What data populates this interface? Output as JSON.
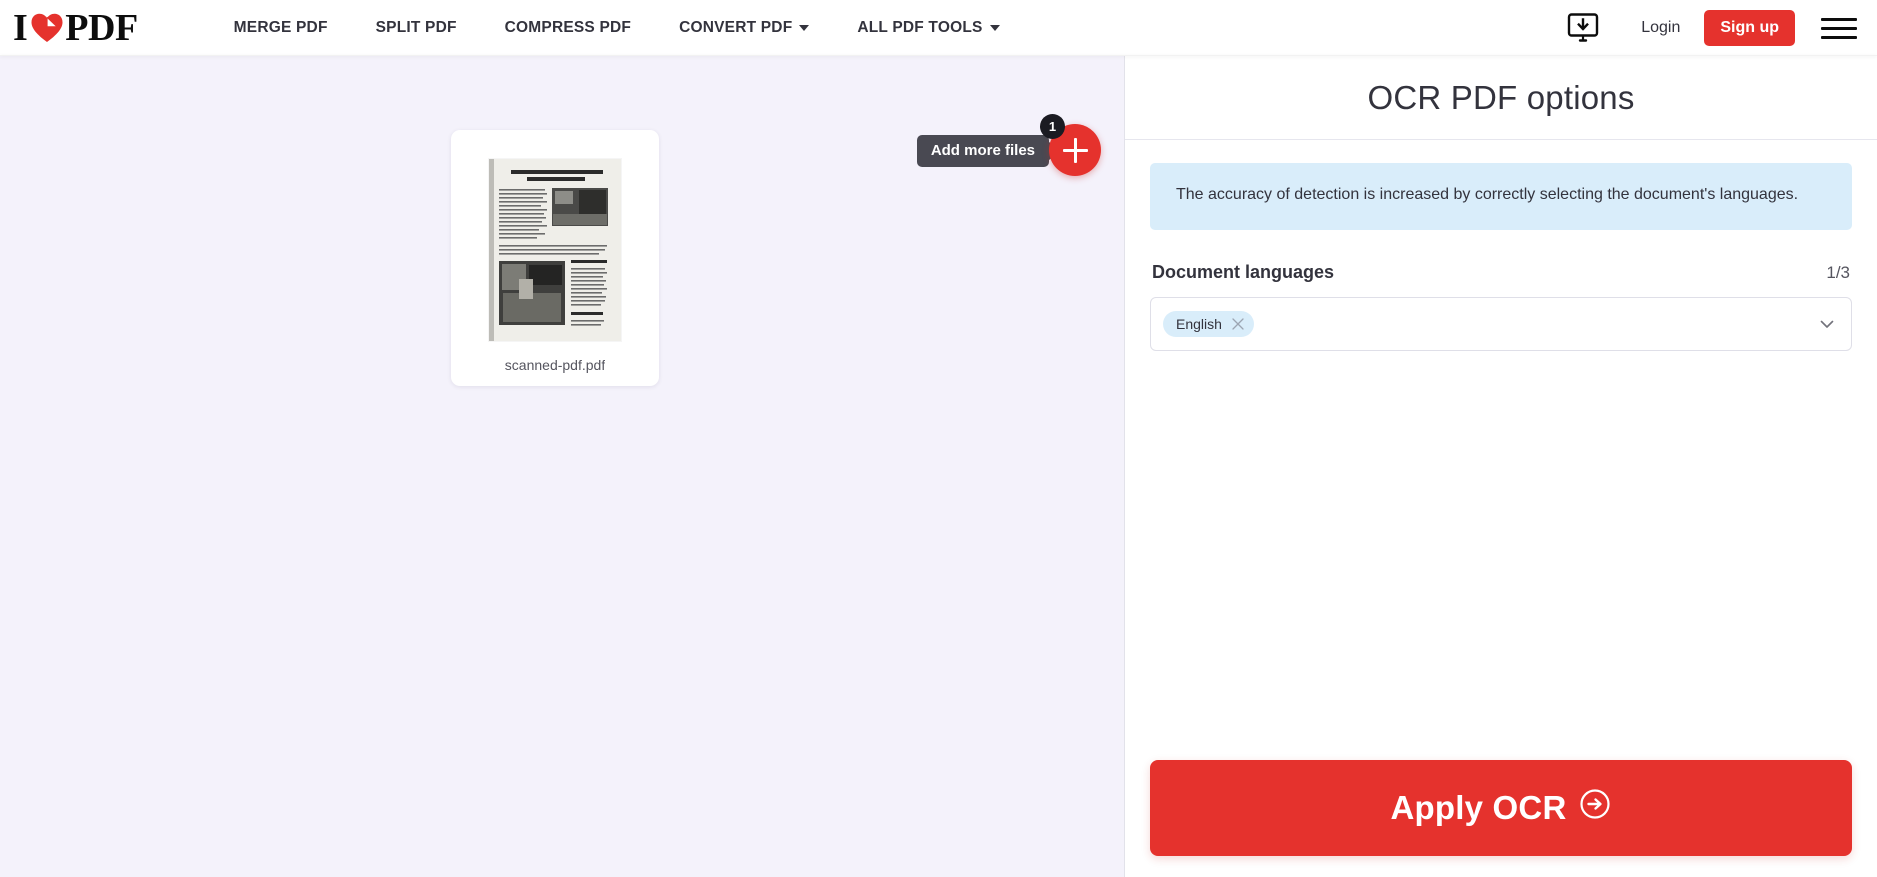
{
  "header": {
    "logo": {
      "left_text": "I",
      "right_text": "PDF",
      "heart_icon": "heart-page-fold-icon",
      "alt": "I LOVE PDF"
    },
    "nav": [
      {
        "label": "MERGE PDF",
        "has_caret": false,
        "name": "nav-merge-pdf"
      },
      {
        "label": "SPLIT PDF",
        "has_caret": false,
        "name": "nav-split-pdf"
      },
      {
        "label": "COMPRESS PDF",
        "has_caret": false,
        "name": "nav-compress-pdf"
      },
      {
        "label": "CONVERT PDF",
        "has_caret": true,
        "name": "nav-convert-pdf"
      },
      {
        "label": "ALL PDF TOOLS",
        "has_caret": true,
        "name": "nav-all-pdf-tools"
      }
    ],
    "desktop_icon": "monitor-download-icon",
    "login_label": "Login",
    "signup_label": "Sign up",
    "menu_icon": "hamburger-menu-icon"
  },
  "workspace": {
    "file": {
      "name": "scanned-pdf.pdf",
      "thumbnail_title_line1": "Improve Working Productivity",
      "thumbnail_title_line2": "in Using Apps"
    },
    "add_more_files": {
      "tooltip": "Add more files",
      "badge_count": "1",
      "icon": "plus-icon"
    }
  },
  "panel": {
    "title": "OCR PDF options",
    "info_text": "The accuracy of detection is increased by correctly selecting the document's languages.",
    "languages": {
      "label": "Document languages",
      "count": "1/3",
      "selected": [
        "English"
      ],
      "remove_icon": "close-x-icon",
      "dropdown_icon": "chevron-down-icon"
    },
    "apply_button": {
      "label": "Apply OCR",
      "icon": "arrow-right-circle-icon"
    }
  },
  "colors": {
    "brand_red": "#e5322d",
    "workspace_bg": "#f4f2fb",
    "info_blue": "#d9edfa",
    "chip_blue": "#d9edfa",
    "tooltip_dark": "#494952",
    "badge_black": "#1b1b22",
    "text": "#33333d"
  }
}
